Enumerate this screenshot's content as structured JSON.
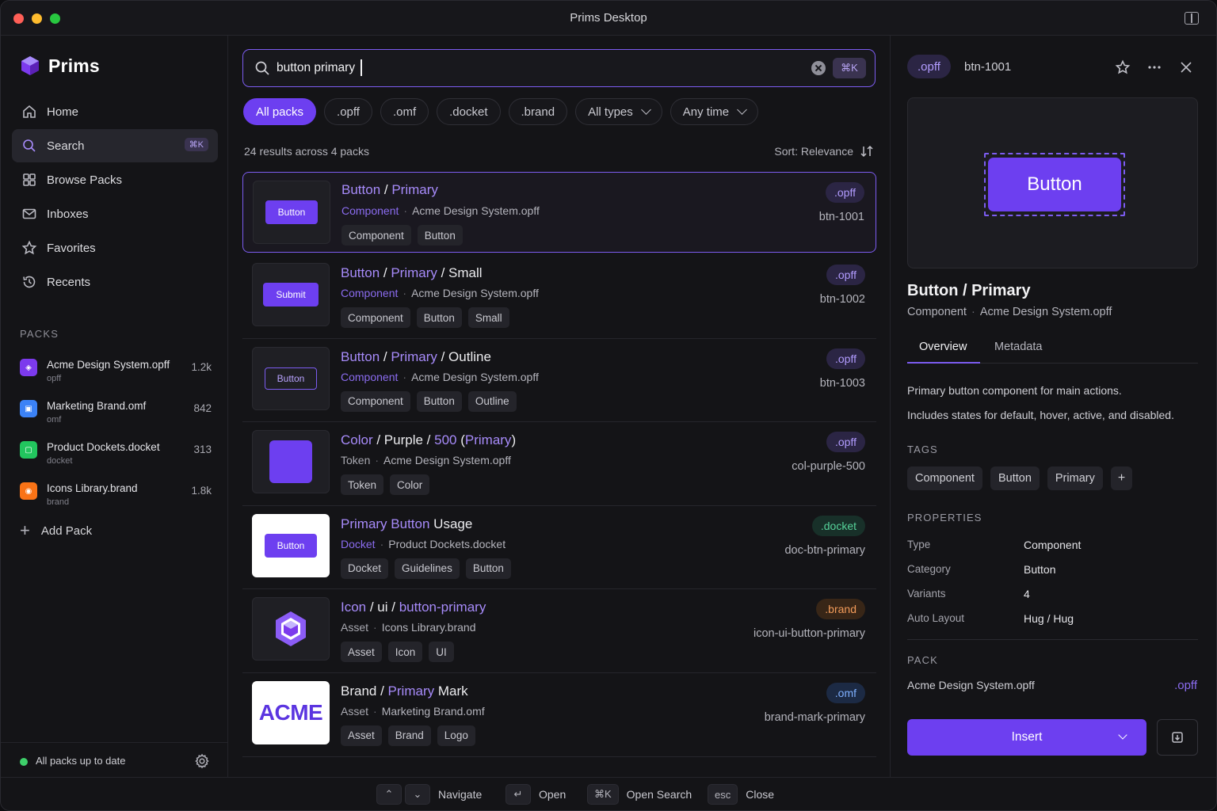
{
  "window": {
    "title": "Prims Desktop"
  },
  "brand": {
    "name": "Prims"
  },
  "nav": {
    "home": "Home",
    "search": "Search",
    "search_kbd": "⌘K",
    "browse": "Browse Packs",
    "inboxes": "Inboxes",
    "favorites": "Favorites",
    "recents": "Recents"
  },
  "packs": {
    "heading": "PACKS",
    "items": [
      {
        "name": "Acme Design System.opff",
        "ext": "opff",
        "count": "1.2k",
        "color": "#7c3aed"
      },
      {
        "name": "Marketing Brand.omf",
        "ext": "omf",
        "count": "842",
        "color": "#3b82f6"
      },
      {
        "name": "Product Dockets.docket",
        "ext": "docket",
        "count": "313",
        "color": "#22c55e"
      },
      {
        "name": "Icons Library.brand",
        "ext": "brand",
        "count": "1.8k",
        "color": "#f97316"
      }
    ],
    "add_label": "Add Pack"
  },
  "status": {
    "text": "All packs up to date"
  },
  "search": {
    "value": "button primary",
    "kbd": "⌘K"
  },
  "filters": {
    "chips": [
      "All packs",
      ".opff",
      ".omf",
      ".docket",
      ".brand"
    ],
    "type_select": "All types",
    "time_select": "Any time"
  },
  "results_meta": {
    "count_text": "24 results across 4 packs",
    "sort_text": "Sort: Relevance"
  },
  "results": [
    {
      "title_parts": [
        {
          "t": "Button",
          "h": true
        },
        {
          "t": " / ",
          "h": false
        },
        {
          "t": "Primary",
          "h": true
        }
      ],
      "kind": "Component",
      "pack": "Acme Design System.opff",
      "tags": [
        "Component",
        "Button"
      ],
      "badge": ".opff",
      "id": "btn-1001",
      "thumb": {
        "type": "button",
        "label": "Button"
      }
    },
    {
      "title_parts": [
        {
          "t": "Button",
          "h": true
        },
        {
          "t": " / ",
          "h": false
        },
        {
          "t": "Primary",
          "h": true
        },
        {
          "t": " / Small",
          "h": false
        }
      ],
      "kind": "Component",
      "pack": "Acme Design System.opff",
      "tags": [
        "Component",
        "Button",
        "Small"
      ],
      "badge": ".opff",
      "id": "btn-1002",
      "thumb": {
        "type": "button",
        "label": "Submit"
      }
    },
    {
      "title_parts": [
        {
          "t": "Button",
          "h": true
        },
        {
          "t": " / ",
          "h": false
        },
        {
          "t": "Primary",
          "h": true
        },
        {
          "t": " / Outline",
          "h": false
        }
      ],
      "kind": "Component",
      "pack": "Acme Design System.opff",
      "tags": [
        "Component",
        "Button",
        "Outline"
      ],
      "badge": ".opff",
      "id": "btn-1003",
      "thumb": {
        "type": "outline",
        "label": "Button"
      }
    },
    {
      "title_parts": [
        {
          "t": "Color",
          "h": true
        },
        {
          "t": " / Purple / ",
          "h": false
        },
        {
          "t": "500",
          "h": true
        },
        {
          "t": " (",
          "h": false
        },
        {
          "t": "Primary",
          "h": true
        },
        {
          "t": ")",
          "h": false
        }
      ],
      "kind": "Token",
      "pack": "Acme Design System.opff",
      "tags": [
        "Token",
        "Color"
      ],
      "badge": ".opff",
      "id": "col-purple-500",
      "thumb": {
        "type": "swatch",
        "label": ""
      }
    },
    {
      "title_parts": [
        {
          "t": "Primary Button",
          "h": true
        },
        {
          "t": " Usage",
          "h": false
        }
      ],
      "kind": "Docket",
      "pack": "Product Dockets.docket",
      "tags": [
        "Docket",
        "Guidelines",
        "Button"
      ],
      "badge": ".docket",
      "id": "doc-btn-primary",
      "thumb": {
        "type": "button-light",
        "label": "Button"
      }
    },
    {
      "title_parts": [
        {
          "t": "Icon",
          "h": true
        },
        {
          "t": " / ui / ",
          "h": false
        },
        {
          "t": "button-primary",
          "h": true
        }
      ],
      "kind": "Asset",
      "pack": "Icons Library.brand",
      "tags": [
        "Asset",
        "Icon",
        "UI"
      ],
      "badge": ".brand",
      "id": "icon-ui-button-primary",
      "thumb": {
        "type": "cube",
        "label": ""
      }
    },
    {
      "title_parts": [
        {
          "t": "Brand / ",
          "h": false
        },
        {
          "t": "Primary",
          "h": true
        },
        {
          "t": " Mark",
          "h": false
        }
      ],
      "kind": "Asset",
      "pack": "Marketing Brand.omf",
      "tags": [
        "Asset",
        "Brand",
        "Logo"
      ],
      "badge": ".omf",
      "id": "brand-mark-primary",
      "thumb": {
        "type": "acme",
        "label": "ACME"
      }
    }
  ],
  "detail": {
    "badge": ".opff",
    "id": "btn-1001",
    "preview_label": "Button",
    "title": "Button / Primary",
    "kind": "Component",
    "pack": "Acme Design System.opff",
    "tabs": [
      "Overview",
      "Metadata"
    ],
    "desc1": "Primary button component for main actions.",
    "desc2": "Includes states for default, hover, active, and disabled.",
    "tags_heading": "TAGS",
    "tags": [
      "Component",
      "Button",
      "Primary"
    ],
    "add_tag": "+",
    "props_heading": "PROPERTIES",
    "props": [
      {
        "k": "Type",
        "v": "Component"
      },
      {
        "k": "Category",
        "v": "Button"
      },
      {
        "k": "Variants",
        "v": "4"
      },
      {
        "k": "Auto Layout",
        "v": "Hug / Hug"
      }
    ],
    "pack_heading": "PACK",
    "pack_name": "Acme Design System.opff",
    "pack_ext": ".opff",
    "insert_label": "Insert"
  },
  "footer": {
    "navigate": "Navigate",
    "open_kbd": "↵",
    "open": "Open",
    "search_kbd": "⌘K",
    "open_search": "Open Search",
    "esc_kbd": "esc",
    "close": "Close"
  },
  "colors": {
    "accent": "#6d3ff0",
    "accent_light": "#a78bfa",
    "bg": "#141417"
  }
}
